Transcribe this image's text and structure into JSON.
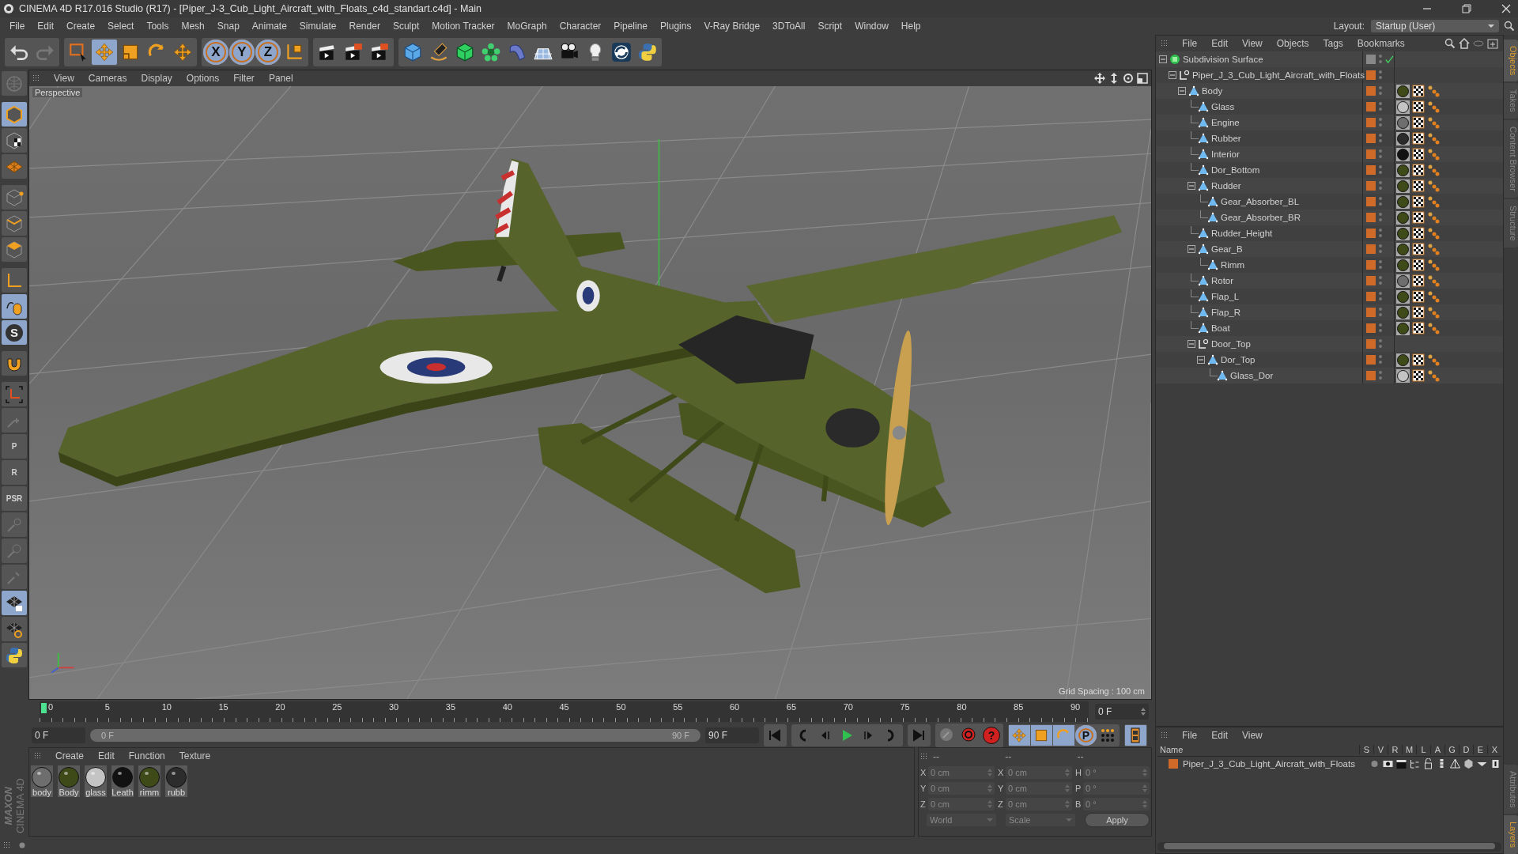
{
  "window": {
    "title": "CINEMA 4D R17.016 Studio (R17) - [Piper_J-3_Cub_Light_Aircraft_with_Floats_c4d_standart.c4d] - Main"
  },
  "menu": [
    "File",
    "Edit",
    "Create",
    "Select",
    "Tools",
    "Mesh",
    "Snap",
    "Animate",
    "Simulate",
    "Render",
    "Sculpt",
    "Motion Tracker",
    "MoGraph",
    "Character",
    "Pipeline",
    "Plugins",
    "V-Ray Bridge",
    "3DToAll",
    "Script",
    "Window",
    "Help"
  ],
  "layout": {
    "label": "Layout:",
    "value": "Startup (User)"
  },
  "toolbar": {
    "axis_buttons": [
      "X",
      "Y",
      "Z"
    ]
  },
  "left_toolbar": {
    "snap_label": "S",
    "lock_labels": [
      "P",
      "R",
      "PSR"
    ]
  },
  "viewport": {
    "menu": [
      "View",
      "Cameras",
      "Display",
      "Options",
      "Filter",
      "Panel"
    ],
    "camera": "Perspective",
    "grid_spacing": "Grid Spacing : 100 cm"
  },
  "timeline": {
    "ticks": [
      "0",
      "5",
      "10",
      "15",
      "20",
      "25",
      "30",
      "35",
      "40",
      "45",
      "50",
      "55",
      "60",
      "65",
      "70",
      "75",
      "80",
      "85",
      "90"
    ],
    "current_frame": "0 F",
    "start_field": "0 F",
    "range_start": "0 F",
    "range_end": "90 F",
    "range_slider": {
      "level": 1
    },
    "end_field": "90 F",
    "key_label": "P",
    "help_symbol": "?"
  },
  "materials": {
    "menu": [
      "Create",
      "Edit",
      "Function",
      "Texture"
    ],
    "items": [
      {
        "name": "body",
        "color": "#6e6e6e"
      },
      {
        "name": "Body",
        "color": "#3e4a18"
      },
      {
        "name": "glass",
        "color": "#c4c4c4"
      },
      {
        "name": "Leath",
        "color": "#121212"
      },
      {
        "name": "rimm",
        "color": "#3e4a18"
      },
      {
        "name": "rubb",
        "color": "#2c2c2c"
      }
    ]
  },
  "coordinates": {
    "headers": [
      "--",
      "--",
      "--"
    ],
    "rows": [
      [
        {
          "label": "X",
          "value": "0 cm"
        },
        {
          "label": "X",
          "value": "0 cm"
        },
        {
          "label": "H",
          "value": "0 °"
        }
      ],
      [
        {
          "label": "Y",
          "value": "0 cm"
        },
        {
          "label": "Y",
          "value": "0 cm"
        },
        {
          "label": "P",
          "value": "0 °"
        }
      ],
      [
        {
          "label": "Z",
          "value": "0 cm"
        },
        {
          "label": "Z",
          "value": "0 cm"
        },
        {
          "label": "B",
          "value": "0 °"
        }
      ]
    ],
    "dropdowns": [
      "World",
      "Scale"
    ],
    "apply": "Apply",
    "disabled": true
  },
  "objects": {
    "menu": [
      "File",
      "Edit",
      "View",
      "Objects",
      "Tags",
      "Bookmarks"
    ],
    "tree": [
      {
        "name": "Subdivision Surface",
        "kind": "subdivision",
        "expanded": true,
        "enabled": true,
        "children": [
          {
            "name": "Piper_J_3_Cub_Light_Aircraft_with_Floats",
            "kind": "null",
            "expanded": true,
            "children": [
              {
                "name": "Body",
                "kind": "polygon",
                "color": "#3e4a18",
                "expanded": true,
                "children": [
                  {
                    "name": "Glass",
                    "kind": "polygon",
                    "color": "#c4c4c4"
                  },
                  {
                    "name": "Engine",
                    "kind": "polygon",
                    "color": "#6e6e6e"
                  },
                  {
                    "name": "Rubber",
                    "kind": "polygon",
                    "color": "#2c2c2c"
                  },
                  {
                    "name": "Interior",
                    "kind": "polygon",
                    "color": "#121212"
                  },
                  {
                    "name": "Dor_Bottom",
                    "kind": "polygon",
                    "color": "#3e4a18"
                  },
                  {
                    "name": "Rudder",
                    "kind": "polygon",
                    "color": "#3e4a18",
                    "expanded": true,
                    "children": [
                      {
                        "name": "Gear_Absorber_BL",
                        "kind": "polygon",
                        "color": "#3e4a18"
                      },
                      {
                        "name": "Gear_Absorber_BR",
                        "kind": "polygon",
                        "color": "#3e4a18"
                      }
                    ]
                  },
                  {
                    "name": "Rudder_Height",
                    "kind": "polygon",
                    "color": "#3e4a18"
                  },
                  {
                    "name": "Gear_B",
                    "kind": "polygon",
                    "color": "#3e4a18",
                    "expanded": true,
                    "children": [
                      {
                        "name": "Rimm",
                        "kind": "polygon",
                        "color": "#3e4a18"
                      }
                    ]
                  },
                  {
                    "name": "Rotor",
                    "kind": "polygon",
                    "color": "#6e6e6e"
                  },
                  {
                    "name": "Flap_L",
                    "kind": "polygon",
                    "color": "#3e4a18"
                  },
                  {
                    "name": "Flap_R",
                    "kind": "polygon",
                    "color": "#3e4a18"
                  },
                  {
                    "name": "Boat",
                    "kind": "polygon",
                    "color": "#3e4a18"
                  },
                  {
                    "name": "Door_Top",
                    "kind": "null",
                    "expanded": true,
                    "children": [
                      {
                        "name": "Dor_Top",
                        "kind": "polygon",
                        "color": "#3e4a18",
                        "expanded": true,
                        "children": [
                          {
                            "name": "Glass_Dor",
                            "kind": "polygon",
                            "color": "#c4c4c4"
                          }
                        ]
                      }
                    ]
                  }
                ]
              }
            ]
          }
        ]
      }
    ]
  },
  "layers": {
    "menu": [
      "File",
      "Edit",
      "View"
    ],
    "columns": [
      "Name",
      "S",
      "V",
      "R",
      "M",
      "L",
      "A",
      "G",
      "D",
      "E",
      "X"
    ],
    "rows": [
      {
        "name": "Piper_J_3_Cub_Light_Aircraft_with_Floats"
      }
    ]
  },
  "side_tabs_top": [
    {
      "label": "Objects",
      "selected": true
    },
    {
      "label": "Takes",
      "selected": false
    },
    {
      "label": "Content Browser",
      "selected": false
    },
    {
      "label": "Structure",
      "selected": false
    }
  ],
  "side_tabs_bottom": [
    {
      "label": "Attributes",
      "selected": false
    },
    {
      "label": "Layers",
      "selected": true
    }
  ],
  "logo": {
    "brand": "MAXON",
    "product": "CINEMA 4D"
  }
}
